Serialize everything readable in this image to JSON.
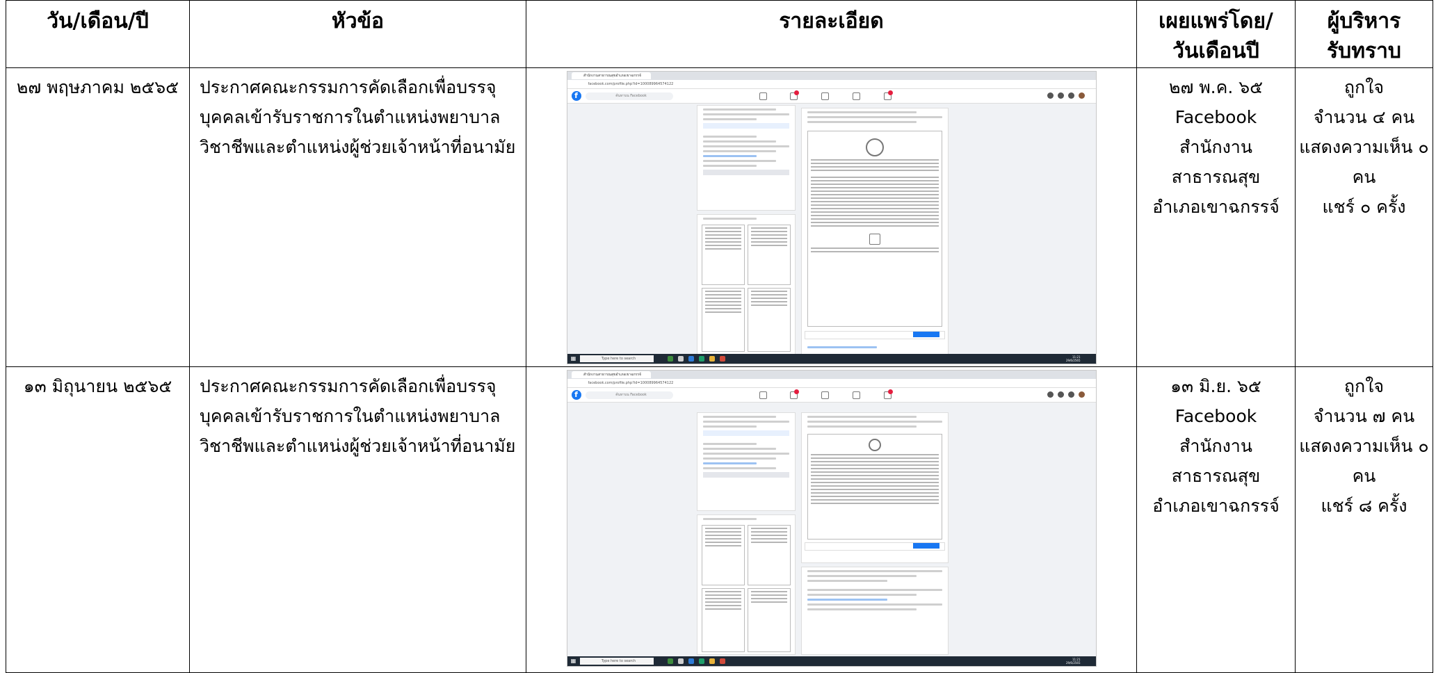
{
  "headers": {
    "date": "วัน/เดือน/ปี",
    "topic": "หัวข้อ",
    "detail": "รายละเอียด",
    "published": [
      "เผยแพร่โดย/",
      "วันเดือนปี"
    ],
    "acknowledged": [
      "ผู้บริหาร",
      "รับทราบ"
    ]
  },
  "rows": [
    {
      "date": "๒๗ พฤษภาคม ๒๕๖๕",
      "topic": "ประกาศคณะกรรมการคัดเลือกเพื่อบรรจุบุคคลเข้ารับราชการในตำแหน่งพยาบาลวิชาชีพและตำแหน่งผู้ช่วยเจ้าหน้าที่อนามัย",
      "published": [
        "๒๗ พ.ค. ๖๕",
        "Facebook",
        "สำนักงานสาธารณสุข",
        "อำเภอเขาฉกรรจ์"
      ],
      "acknowledged": [
        "ถูกใจ",
        "จำนวน ๔ คน",
        "แสดงความเห็น ๐",
        "คน",
        "แชร์ ๐ ครั้ง"
      ],
      "screenshot": {
        "tab": "สำนักงานสาธารณสุขอำเภอเขาฉกรรจ์",
        "url": "facebook.com/profile.php?id=100089964574122",
        "search": "ค้นหาบน Facebook",
        "taskbar_search": "Type here to search",
        "time": [
          "11:21",
          "29/6/2565"
        ]
      }
    },
    {
      "date": "๑๓ มิถุนายน ๒๕๖๕",
      "topic": "ประกาศคณะกรรมการคัดเลือกเพื่อบรรจุบุคคลเข้ารับราชการในตำแหน่งพยาบาลวิชาชีพและตำแหน่งผู้ช่วยเจ้าหน้าที่อนามัย",
      "published": [
        "๑๓ มิ.ย. ๖๕",
        "Facebook",
        "สำนักงานสาธารณสุข",
        "อำเภอเขาฉกรรจ์"
      ],
      "acknowledged": [
        "ถูกใจ",
        "จำนวน ๗ คน",
        "แสดงความเห็น ๐",
        "คน",
        "แชร์ ๘ ครั้ง"
      ],
      "screenshot": {
        "tab": "สำนักงานสาธารณสุขอำเภอเขาฉกรรจ์",
        "url": "facebook.com/profile.php?id=100089964574122",
        "search": "ค้นหาบน Facebook",
        "taskbar_search": "Type here to search",
        "time": [
          "11:21",
          "29/6/2565"
        ]
      }
    }
  ]
}
